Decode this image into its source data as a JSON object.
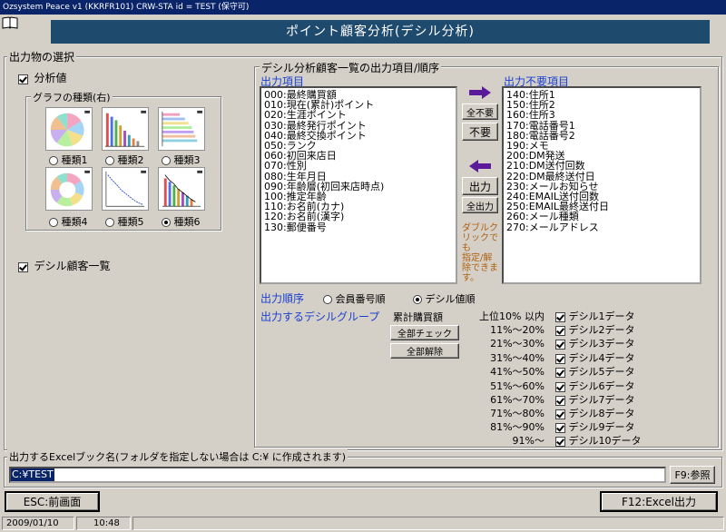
{
  "window": {
    "title": "Ozsystem Peace v1 (KKRFR101)    CRW-STA    id = TEST     (保守可)"
  },
  "banner": {
    "title": "ポイント顧客分析(デシル分析)"
  },
  "output_select": {
    "legend": "出力物の選択",
    "analysis_value": {
      "label": "分析値",
      "checked": true
    },
    "graph_group": {
      "legend": "グラフの種類(右)",
      "options": [
        {
          "label": "種類1",
          "selected": false
        },
        {
          "label": "種類2",
          "selected": false
        },
        {
          "label": "種類3",
          "selected": false
        },
        {
          "label": "種類4",
          "selected": false
        },
        {
          "label": "種類5",
          "selected": false
        },
        {
          "label": "種類6",
          "selected": true
        }
      ]
    },
    "decile_list": {
      "label": "デシル顧客一覧",
      "checked": true
    }
  },
  "items_group": {
    "legend": "デシル分析顧客一覧の出力項目/順序",
    "output_header": "出力項目",
    "unneeded_header": "出力不要項目",
    "output_items": [
      "000:最終購買額",
      "010:現在(累計)ポイント",
      "020:生涯ポイント",
      "030:最終発行ポイント",
      "040:最終交換ポイント",
      "050:ランク",
      "060:初回来店日",
      "070:性別",
      "080:生年月日",
      "090:年齢層(初回来店時点)",
      "100:推定年齢",
      "110:お名前(カナ)",
      "120:お名前(漢字)",
      "130:郵便番号"
    ],
    "unneeded_items": [
      "140:住所1",
      "150:住所2",
      "160:住所3",
      "170:電話番号1",
      "180:電話番号2",
      "190:メモ",
      "200:DM発送",
      "210:DM送付回数",
      "220:DM最終送付日",
      "230:メールお知らせ",
      "240:EMAIL送付回数",
      "250:EMAIL最終送付日",
      "260:メール種類",
      "270:メールアドレス"
    ],
    "buttons": {
      "all_unneeded": "全不要",
      "unneeded": "不要",
      "output": "出力",
      "all_output": "全出力"
    },
    "hint": [
      "ダブルク",
      "リックでも",
      "指定/解",
      "除できま",
      "す。"
    ],
    "order_label": "出力順序",
    "order_options": [
      {
        "label": "会員番号順",
        "selected": false
      },
      {
        "label": "デシル値順",
        "selected": true
      }
    ],
    "decile_group_label": "出力するデシルグループ",
    "cumulative_label": "累計購買額",
    "check_all": "全部チェック",
    "uncheck_all": "全部解除",
    "ranges": [
      "上位10% 以内",
      "11%～20%",
      "21%～30%",
      "31%～40%",
      "41%～50%",
      "51%～60%",
      "61%～70%",
      "71%～80%",
      "81%～90%",
      "91%～"
    ],
    "deciles": [
      {
        "label": "デシル1データ",
        "checked": true
      },
      {
        "label": "デシル2データ",
        "checked": true
      },
      {
        "label": "デシル3データ",
        "checked": true
      },
      {
        "label": "デシル4データ",
        "checked": true
      },
      {
        "label": "デシル5データ",
        "checked": true
      },
      {
        "label": "デシル6データ",
        "checked": true
      },
      {
        "label": "デシル7データ",
        "checked": true
      },
      {
        "label": "デシル8データ",
        "checked": true
      },
      {
        "label": "デシル9データ",
        "checked": true
      },
      {
        "label": "デシル10データ",
        "checked": true
      }
    ]
  },
  "excel": {
    "legend": "出力するExcelブック名(フォルダを指定しない場合は C:¥ に作成されます)",
    "value": "C:¥TEST",
    "browse_label": "F9:参照"
  },
  "footer": {
    "back_label": "ESC:前画面",
    "excel_label": "F12:Excel出力"
  },
  "status": {
    "date": "2009/01/10",
    "time": "10:48"
  },
  "colors": {
    "titlebar": "#0a246a",
    "banner": "#1e4a6e",
    "arrow": "#5a1a9a",
    "link_blue": "#1a3fd0",
    "hint": "#b06010"
  }
}
